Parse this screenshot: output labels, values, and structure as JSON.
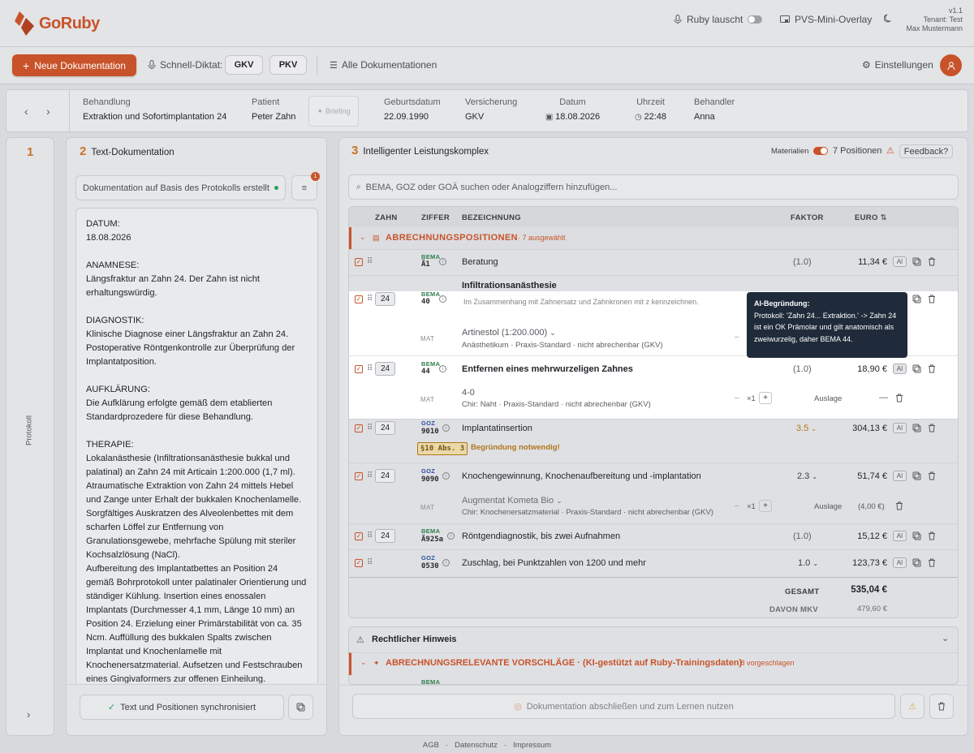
{
  "app": {
    "brand": "GoRuby",
    "version": "v1.1",
    "tenant": "Tenant: Test",
    "user": "Max Mustermann",
    "listening_label": "Ruby lauscht",
    "overlay_label": "PVS-Mini-Overlay"
  },
  "actions": {
    "new_doc": "Neue Dokumentation",
    "quick_dictation": "Schnell-Diktat:",
    "gkv": "GKV",
    "pkv": "PKV",
    "all_docs": "Alle Dokumentationen",
    "settings": "Einstellungen"
  },
  "patient_bar": {
    "behandlung_label": "Behandlung",
    "behandlung": "Extraktion und Sofortimplantation 24",
    "patient_label": "Patient",
    "patient": "Peter Zahn",
    "briefing": "Briefing",
    "geburtsdatum_label": "Geburtsdatum",
    "geburtsdatum": "22.09.1990",
    "versicherung_label": "Versicherung",
    "versicherung": "GKV",
    "datum_label": "Datum",
    "datum": "18.08.2026",
    "uhrzeit_label": "Uhrzeit",
    "uhrzeit": "22:48",
    "behandler_label": "Behandler",
    "behandler": "Anna"
  },
  "col1": {
    "num": "1",
    "label": "Protokoll"
  },
  "col2": {
    "num": "2",
    "title": "Text-Dokumentation",
    "dropdown": "Dokumentation auf Basis des Protokolls erstellt",
    "filter_badge": "1",
    "sync": "Text und Positionen synchronisiert",
    "text": "DATUM:\n18.08.2026\n\nANAMNESE:\nLängsfraktur an Zahn 24. Der Zahn ist nicht erhaltungswürdig.\n\nDIAGNOSTIK:\nKlinische Diagnose einer Längsfraktur an Zahn 24. Postoperative Röntgenkontrolle zur Überprüfung der Implantatposition.\n\nAUFKLÄRUNG:\nDie Aufklärung erfolgte gemäß dem etablierten Standardprozedere für diese Behandlung.\n\nTHERAPIE:\nLokalanästhesie (Infiltrationsanästhesie bukkal und palatinal) an Zahn 24 mit Articain 1:200.000 (1,7 ml). Atraumatische Extraktion von Zahn 24 mittels Hebel und Zange unter Erhalt der bukkalen Knochenlamelle. Sorgfältiges Auskratzen des Alveolenbettes mit dem scharfen Löffel zur Entfernung von Granulationsgewebe, mehrfache Spülung mit steriler Kochsalzlösung (NaCl).\nAufbereitung des Implantatbettes an Position 24 gemäß Bohrprotokoll unter palatinaler Orientierung und ständiger Kühlung. Insertion eines enossalen Implantats (Durchmesser 4,1 mm, Länge 10 mm) an Position 24. Erzielung einer Primärstabilität von ca. 35 Ncm. Auffüllung des bukkalen Spalts zwischen Implantat und Knochenlamelle mit Knochenersatzmaterial. Aufsetzen und Festschrauben eines Gingivaformers zur offenen Einheilung. Wundverschluss und Adaptation mittels"
  },
  "col3": {
    "num": "3",
    "title": "Intelligenter Leistungskomplex",
    "materials": "Materialien",
    "positions": "7 Positionen",
    "feedback": "Feedback?",
    "search_placeholder": "BEMA, GOZ oder GOÄ suchen oder Analogziffern hinzufügen...",
    "headers": {
      "zahn": "ZAHN",
      "ziffer": "ZIFFER",
      "bez": "BEZEICHNUNG",
      "faktor": "FAKTOR",
      "euro": "EURO"
    },
    "group": {
      "title": "ABRECHNUNGSPOSITIONEN",
      "count": "· 7 ausgewählt"
    },
    "rows": [
      {
        "cat": "BEMA",
        "code": "Ä1",
        "desc": "Beratung",
        "factor": "(1.0)",
        "euro": "11,34 €"
      },
      {
        "tooth": "24",
        "cat": "BEMA",
        "code": "40",
        "desc": "Infiltrationsanästhesie",
        "note": "Im Zusammenhang mit Zahnersatz und Zahnkronen mit z kennzeichnen.",
        "mat_label": "MAT",
        "mat_name": "Artinestol (1:200.000)",
        "mat_sub": "Anästhetikum · Praxis-Standard · nicht abrechenbar (GKV)"
      },
      {
        "tooth": "24",
        "cat": "BEMA",
        "code": "44",
        "desc": "Entfernen eines mehrwurzeligen Zahnes",
        "factor": "(1.0)",
        "euro": "18,90 €",
        "mat_label": "MAT",
        "mat_name": "4-0",
        "mat_sub": "Chir: Naht · Praxis-Standard · nicht abrechenbar (GKV)",
        "qty": "×1",
        "auslage": "Auslage",
        "dash": "—"
      },
      {
        "tooth": "24",
        "cat": "GOZ",
        "code": "9010",
        "desc": "Implantatinsertion",
        "factor": "3.5",
        "euro": "304,13 €",
        "tag": "§10 Abs. 3",
        "tag_note": "Begründung notwendig!"
      },
      {
        "tooth": "24",
        "cat": "GOZ",
        "code": "9090",
        "desc": "Knochengewinnung, Knochenaufbereitung und -implantation",
        "factor": "2.3",
        "euro": "51,74 €",
        "mat_label": "MAT",
        "mat_name": "Augmentat Kometa Bio",
        "mat_sub": "Chir: Knochenersatzmaterial · Praxis-Standard · nicht abrechenbar (GKV)",
        "qty": "×1",
        "auslage": "Auslage",
        "mat_price": "(4,00 €)"
      },
      {
        "tooth": "24",
        "cat": "BEMA",
        "code": "Ä925a",
        "desc": "Röntgendiagnostik, bis zwei Aufnahmen",
        "factor": "(1.0)",
        "euro": "15,12 €"
      },
      {
        "cat": "GOZ",
        "code": "0530",
        "desc": "Zuschlag, bei Punktzahlen von 1200 und mehr",
        "factor": "1.0",
        "euro": "123,73 €"
      }
    ],
    "ai": "AI",
    "total_label": "GESAMT",
    "total": "535,04 €",
    "mkv_label": "DAVON MKV",
    "mkv": "479,60 €",
    "legal": "Rechtlicher Hinweis",
    "suggest_title": "ABRECHNUNGSRELEVANTE VORSCHLÄGE · (KI-gestützt auf Ruby-Trainingsdaten)",
    "suggest_count": "· 8 vorgeschlagen",
    "suggest_peek": "BEMA",
    "finish": "Dokumentation abschließen und zum Lernen nutzen"
  },
  "tooltip": {
    "title": "AI-Begründung:",
    "body": "Protokoll: 'Zahn 24... Extraktion.' -> Zahn 24 ist ein OK Prämolar und gilt anatomisch als zweiwurzelig, daher BEMA 44."
  },
  "footer": {
    "agb": "AGB",
    "datenschutz": "Datenschutz",
    "impressum": "Impressum"
  },
  "colors": {
    "brand": "#c8532a",
    "bema": "#2e7d4f",
    "goz": "#2d4f9e",
    "tooltip": "#1f2a3a"
  }
}
